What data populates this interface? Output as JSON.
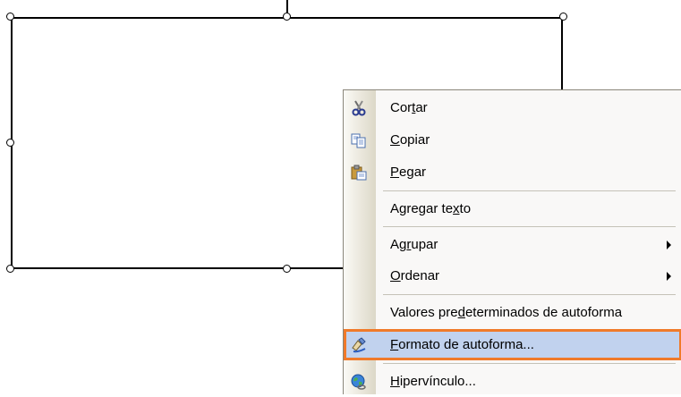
{
  "context_menu": {
    "items": [
      {
        "id": "cut",
        "pre": "Cor",
        "mn": "t",
        "post": "ar",
        "icon": "scissors-icon"
      },
      {
        "id": "copy",
        "pre": "",
        "mn": "C",
        "post": "opiar",
        "icon": "copy-icon"
      },
      {
        "id": "paste",
        "pre": "",
        "mn": "P",
        "post": "egar",
        "icon": "paste-icon"
      },
      {
        "id": "add-text",
        "pre": "Agregar te",
        "mn": "x",
        "post": "to"
      },
      {
        "id": "group",
        "pre": "Ag",
        "mn": "r",
        "post": "upar",
        "submenu": true
      },
      {
        "id": "order",
        "pre": "",
        "mn": "O",
        "post": "rdenar",
        "submenu": true
      },
      {
        "id": "autoshape-defaults",
        "pre": "Valores pre",
        "mn": "d",
        "post": "eterminados de autoforma"
      },
      {
        "id": "format-autoshape",
        "pre": "",
        "mn": "F",
        "post": "ormato de autoforma...",
        "icon": "format-brush-icon",
        "highlighted": true
      },
      {
        "id": "hyperlink",
        "pre": "",
        "mn": "H",
        "post": "ipervínculo...",
        "icon": "globe-link-icon"
      }
    ]
  },
  "colors": {
    "highlight_fill": "#c1d2ee",
    "highlight_border": "#f07a2a"
  }
}
